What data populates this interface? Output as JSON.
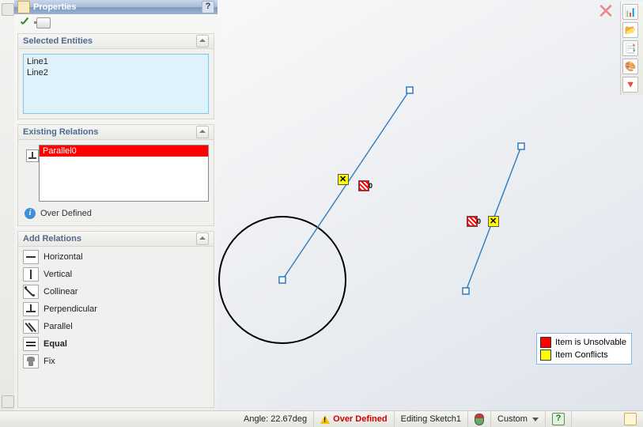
{
  "panel": {
    "title": "Properties",
    "help_glyph": "?"
  },
  "selected_entities": {
    "header": "Selected Entities",
    "items": [
      "Line1",
      "Line2"
    ]
  },
  "existing_relations": {
    "header": "Existing Relations",
    "items": [
      "Parallel0"
    ],
    "status_text": "Over Defined",
    "info_glyph": "i"
  },
  "add_relations": {
    "header": "Add Relations",
    "options": [
      {
        "key": "horizontal",
        "label": "Horizontal",
        "icon": "ri-horiz",
        "bold": false
      },
      {
        "key": "vertical",
        "label": "Vertical",
        "icon": "ri-vert",
        "bold": false
      },
      {
        "key": "collinear",
        "label": "Collinear",
        "icon": "ri-coll",
        "bold": false
      },
      {
        "key": "perpendicular",
        "label": "Perpendicular",
        "icon": "ri-perp",
        "bold": false
      },
      {
        "key": "parallel",
        "label": "Parallel",
        "icon": "ri-para",
        "bold": false
      },
      {
        "key": "equal",
        "label": "Equal",
        "icon": "ri-equal",
        "bold": true
      },
      {
        "key": "fix",
        "label": "Fix",
        "icon": "ri-fix",
        "bold": false
      }
    ]
  },
  "canvas": {
    "relation_badge_sub": "0",
    "close_glyph": "✕"
  },
  "right_toolbar": {
    "buttons": [
      "📊",
      "📂",
      "📑",
      "🎨",
      "🔻"
    ]
  },
  "legend": {
    "unsolvable": "Item is Unsolvable",
    "conflicts": "Item Conflicts"
  },
  "statusbar": {
    "angle_label": "Angle: 22.67deg",
    "over_defined": "Over Defined",
    "editing": "Editing Sketch1",
    "custom_label": "Custom",
    "help_glyph": "?"
  }
}
